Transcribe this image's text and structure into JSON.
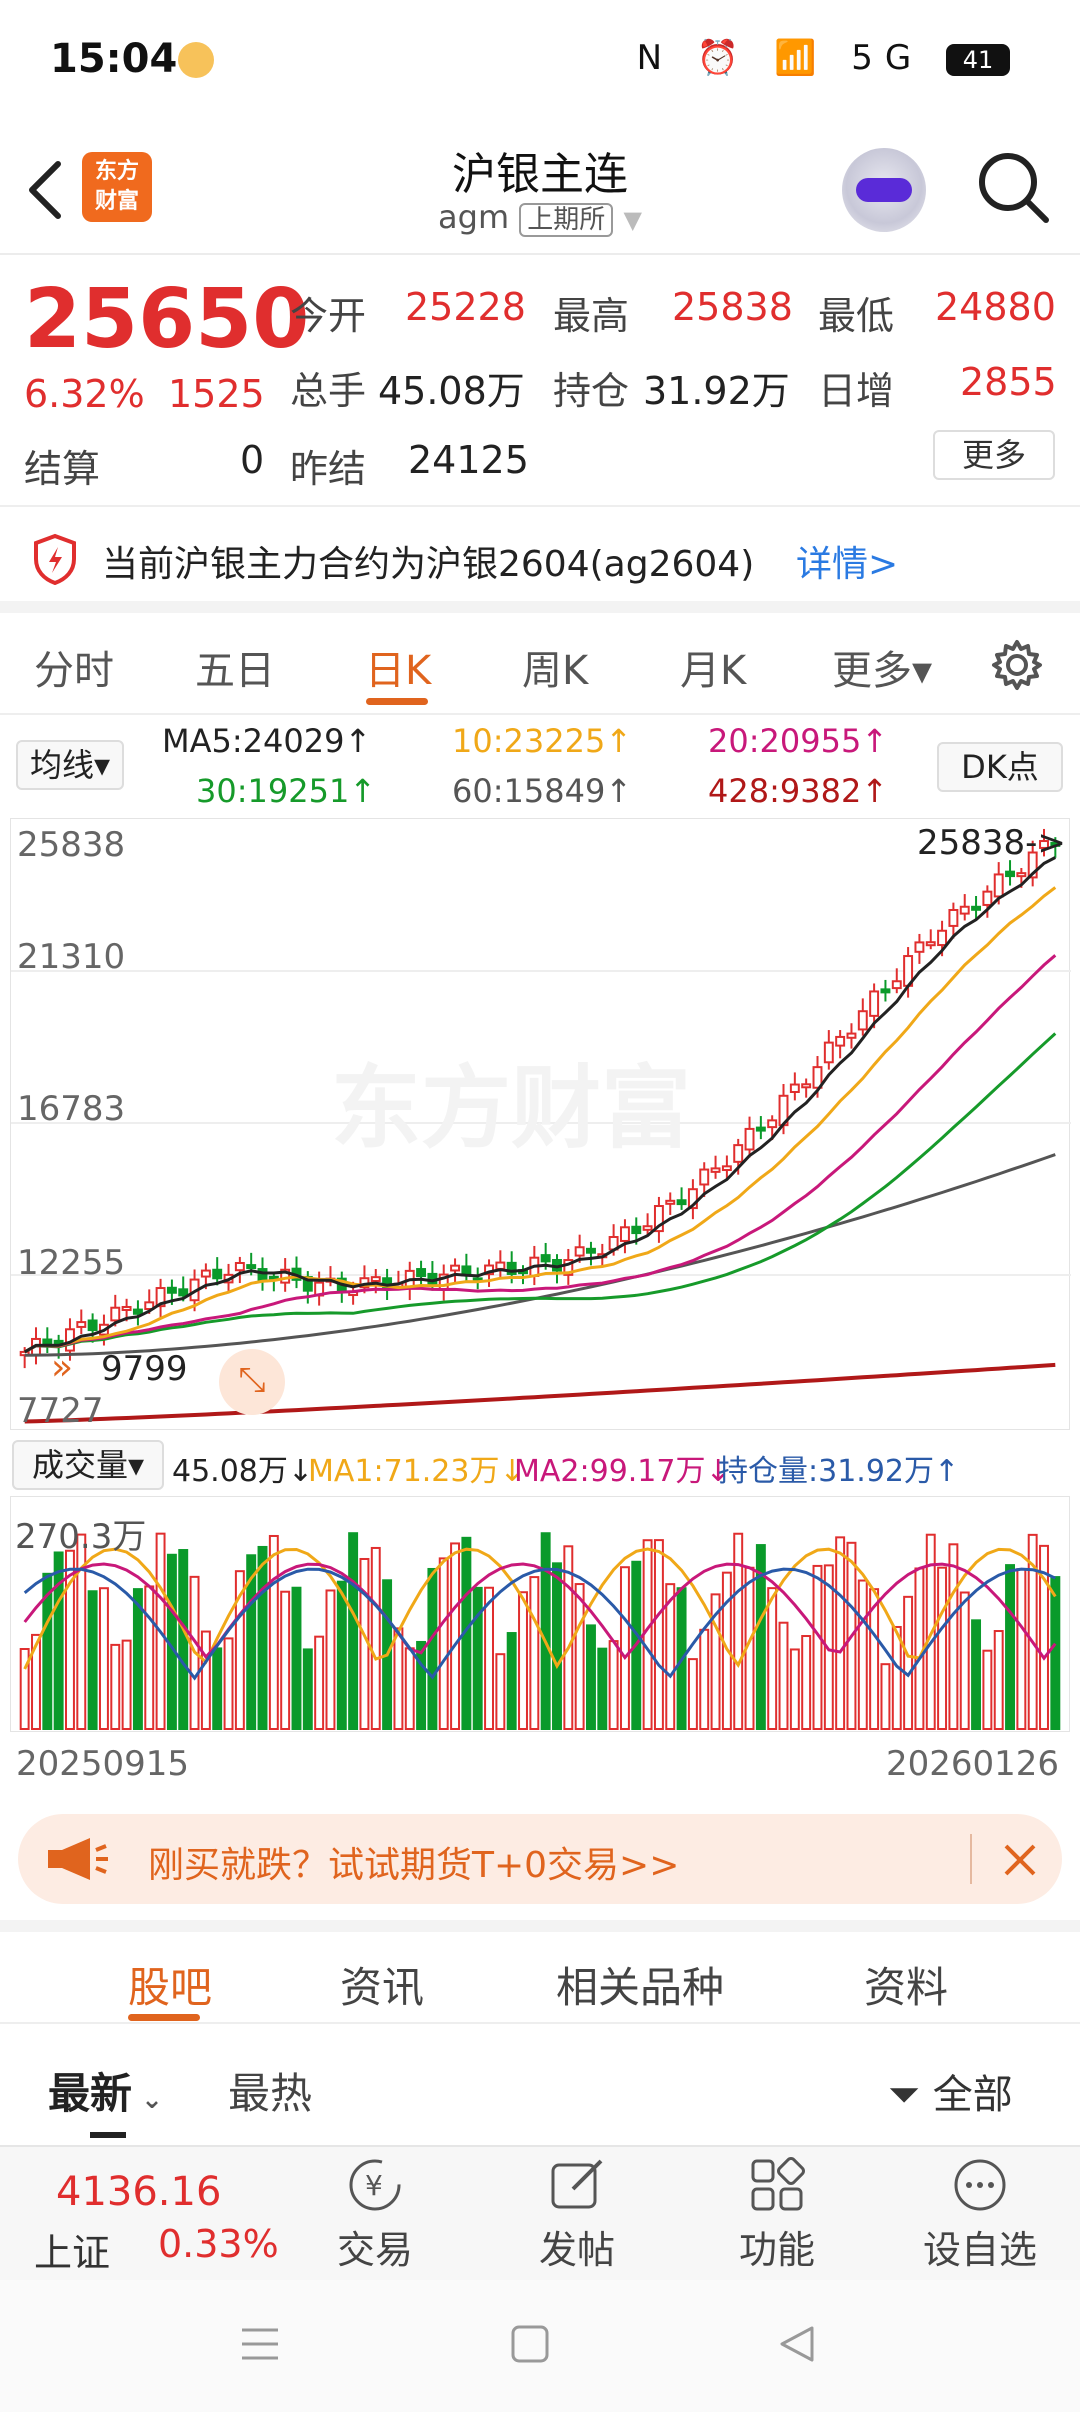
{
  "status": {
    "time": "15:04",
    "icons": "N ⏰ 📶 5G",
    "battery": "41"
  },
  "header": {
    "title": "沪银主连",
    "code": "agm",
    "exchange": "上期所",
    "logo": "东方\n财富"
  },
  "quote": {
    "price": "25650",
    "pct": "6.32%",
    "change": "1525",
    "open_label": "今开",
    "open": "25228",
    "high_label": "最高",
    "high": "25838",
    "low_label": "最低",
    "low": "24880",
    "vol_label": "总手",
    "vol": "45.08万",
    "oi_label": "持仓",
    "oi": "31.92万",
    "day_inc_label": "日增",
    "day_inc": "2855",
    "settle_label": "结算",
    "settle": "0",
    "prev_settle_label": "昨结",
    "prev_settle": "24125",
    "more": "更多"
  },
  "notice": {
    "text": "当前沪银主力合约为沪银2604(ag2604)",
    "link": "详情>"
  },
  "tabs": [
    "分时",
    "五日",
    "日K",
    "周K",
    "月K",
    "更多▾"
  ],
  "ma": {
    "selector": "均线▾",
    "ma5": "MA5:24029↑",
    "ma10": "10:23225↑",
    "ma20": "20:20955↑",
    "ma30": "30:19251↑",
    "ma60": "60:15849↑",
    "ma428": "428:9382↑",
    "dk": "DK点"
  },
  "colors": {
    "up": "#e02e2e",
    "down": "#0a9a2a",
    "accent": "#e0641e",
    "ma5": "#222222",
    "ma10": "#f0a818",
    "ma20": "#c8187a",
    "ma30": "#169a2a",
    "ma60": "#555555",
    "ma428": "#b01818"
  },
  "chart_data": {
    "type": "candlestick",
    "y_axis_labels": [
      "25838",
      "21310",
      "16783",
      "12255",
      "7727"
    ],
    "high_marker": "25838->",
    "low_marker": "9799",
    "ylim": [
      7727,
      25838
    ],
    "x_labels": [
      "20250915",
      "20260126"
    ],
    "volume": {
      "selector": "成交量▾",
      "value": "45.08万↓",
      "ma1": "MA1:71.23万↓",
      "ma2": "MA2:99.17万↓",
      "oi": "持仓量:31.92万↑",
      "max_label": "270.3万"
    }
  },
  "promo": {
    "text": "刚买就跌？试试期货T+0交易>>"
  },
  "subtabs": [
    "股吧",
    "资讯",
    "相关品种",
    "资料"
  ],
  "filters": {
    "latest": "最新",
    "hot": "最热",
    "all": "全部"
  },
  "bottom": {
    "index_value": "4136.16",
    "index_name": "上证",
    "index_pct": "0.33%",
    "trade": "交易",
    "post": "发帖",
    "func": "功能",
    "fav": "设自选"
  }
}
